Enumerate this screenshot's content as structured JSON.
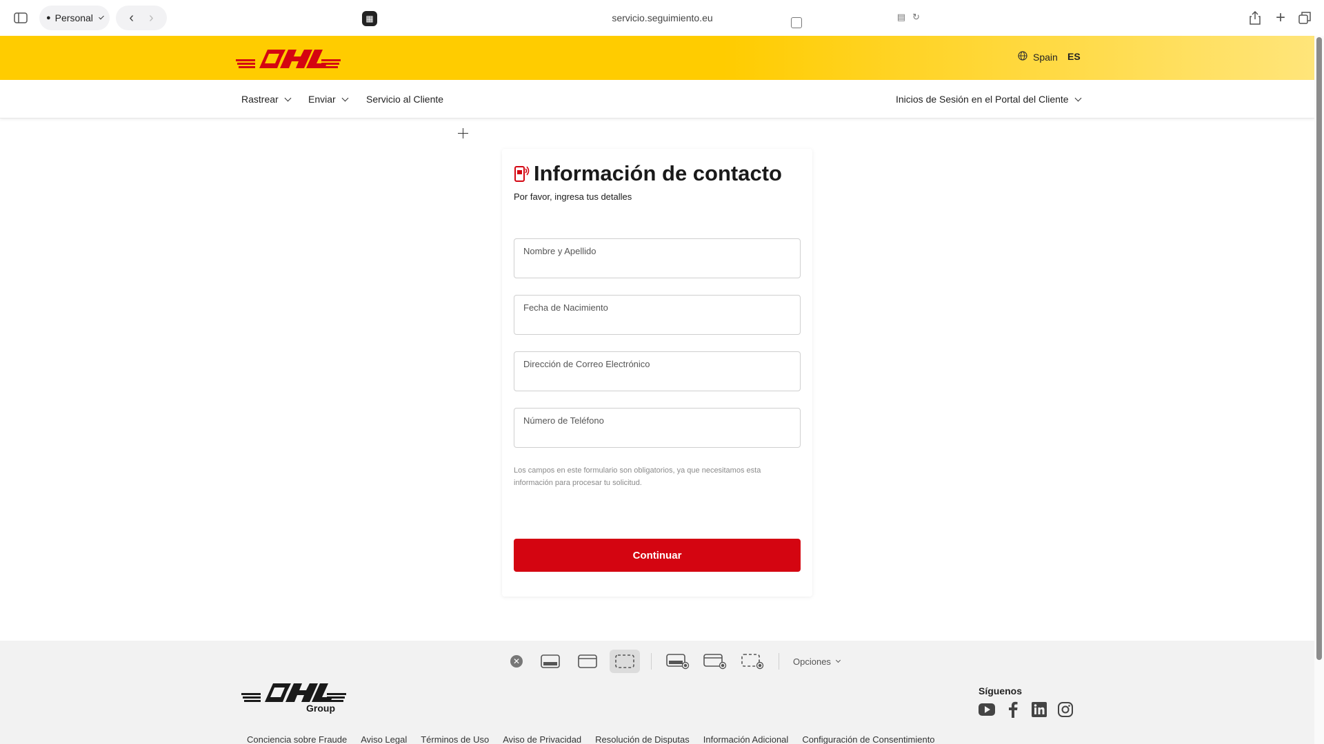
{
  "browser": {
    "profile_label": "Personal",
    "url": "servicio.seguimiento.eu"
  },
  "header": {
    "country": "Spain",
    "language": "ES",
    "brand_color": "#ffcc00",
    "logo_color": "#d40511"
  },
  "nav": {
    "items": [
      {
        "label": "Rastrear"
      },
      {
        "label": "Enviar"
      },
      {
        "label": "Servicio al Cliente"
      }
    ],
    "portal_label": "Inicios de Sesión en el Portal del Cliente"
  },
  "form": {
    "title": "Información de contacto",
    "subtitle": "Por favor, ingresa tus detalles",
    "fields": [
      {
        "label": "Nombre y Apellido",
        "value": ""
      },
      {
        "label": "Fecha de Nacimiento",
        "value": ""
      },
      {
        "label": "Dirección de Correo Electrónico",
        "value": ""
      },
      {
        "label": "Número de Teléfono",
        "value": ""
      }
    ],
    "disclaimer": "Los campos en este formulario son obligatorios, ya que necesitamos esta información para procesar tu solicitud.",
    "submit_label": "Continuar",
    "submit_color": "#d40511"
  },
  "capture_toolbar": {
    "options_label": "Opciones"
  },
  "footer": {
    "logo_sub": "Group",
    "follow_label": "Síguenos",
    "social": [
      "youtube-icon",
      "facebook-icon",
      "linkedin-icon",
      "instagram-icon"
    ],
    "links": [
      "Conciencia sobre Fraude",
      "Aviso Legal",
      "Términos de Uso",
      "Aviso de Privacidad",
      "Resolución de Disputas",
      "Información Adicional",
      "Configuración de Consentimiento"
    ]
  }
}
